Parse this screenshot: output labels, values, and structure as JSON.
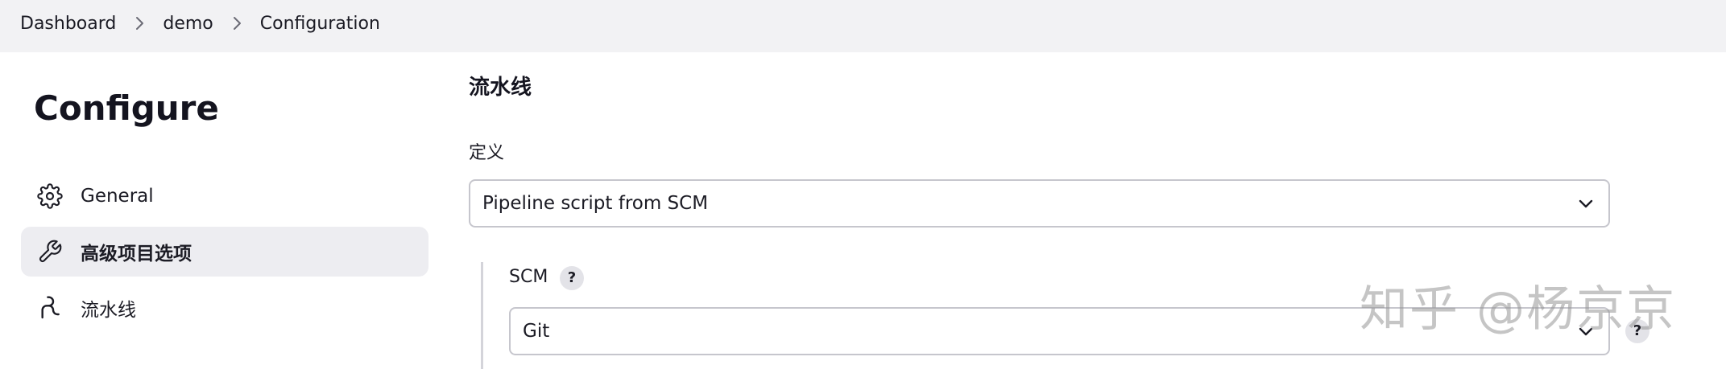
{
  "breadcrumb": {
    "items": [
      "Dashboard",
      "demo",
      "Configuration"
    ]
  },
  "page": {
    "title": "Configure"
  },
  "sidebar": {
    "items": [
      {
        "label": "General",
        "icon": "gear-icon",
        "active": false
      },
      {
        "label": "高级项目选项",
        "icon": "wrench-icon",
        "active": true
      },
      {
        "label": "流水线",
        "icon": "pipeline-icon",
        "active": false
      }
    ]
  },
  "pipeline": {
    "section_title": "流水线",
    "definition_label": "定义",
    "definition_value": "Pipeline script from SCM",
    "scm_label": "SCM",
    "scm_help": "?",
    "scm_value": "Git",
    "scm_value_help": "?"
  },
  "watermark": {
    "text": "知乎 @杨京京"
  },
  "colors": {
    "topbar_bg": "#f2f2f4",
    "active_item_bg": "#ededf1",
    "select_border": "#c6c6cd"
  }
}
